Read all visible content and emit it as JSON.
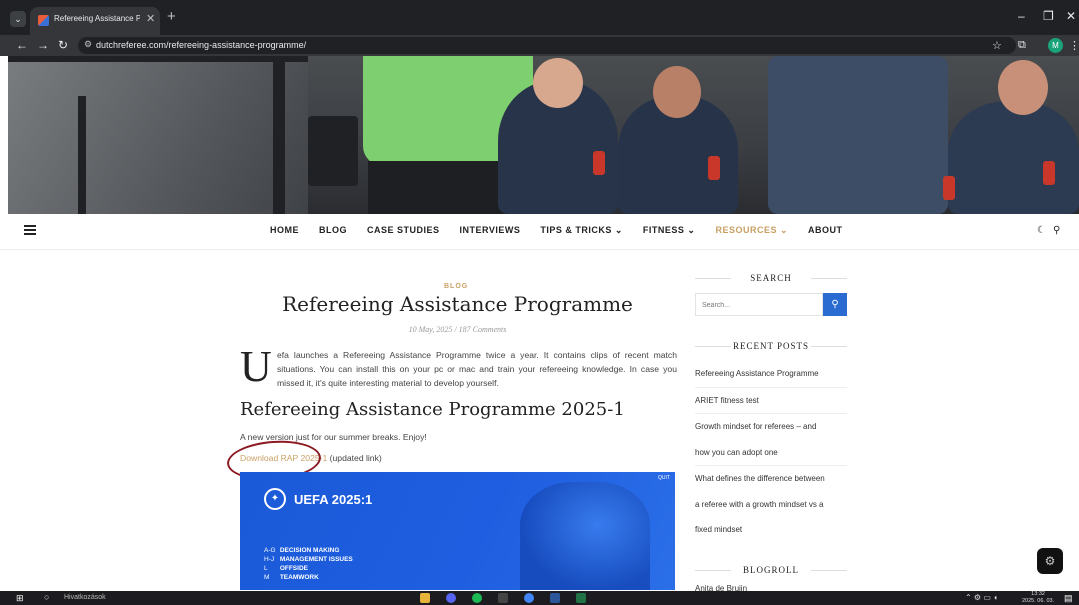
{
  "browser": {
    "tab_title": "Refereeing Assistance Program",
    "url": "dutchreferee.com/refereeing-assistance-programme/",
    "profile_initial": "M"
  },
  "nav": {
    "items": [
      {
        "label": "HOME"
      },
      {
        "label": "BLOG"
      },
      {
        "label": "CASE STUDIES"
      },
      {
        "label": "INTERVIEWS"
      },
      {
        "label": "TIPS & TRICKS ⌄"
      },
      {
        "label": "FITNESS ⌄"
      },
      {
        "label": "RESOURCES ⌄"
      },
      {
        "label": "ABOUT"
      }
    ],
    "active_color": "#c9a063"
  },
  "post": {
    "category": "BLOG",
    "title": "Refereeing Assistance Programme",
    "meta": "10 May, 2025 / 187 Comments",
    "dropcap": "U",
    "intro": "efa launches a Refereeing Assistance Programme twice a year. It contains clips of recent match situations. You can install this on your pc or mac and train your refereeing knowledge. In case you missed it, it's quite interesting material to develop yourself.",
    "subheading": "Refereeing Assistance Programme 2025-1",
    "paragraph": "A new version just for our summer breaks. Enjoy!",
    "download_link": "Download RAP 2025-1",
    "download_suffix": " (updated link)"
  },
  "banner": {
    "title": "UEFA 2025:1",
    "quit": "QUIT",
    "topics": [
      {
        "code": "A-G",
        "label": "DECISION MAKING"
      },
      {
        "code": "H-J",
        "label": "MANAGEMENT ISSUES"
      },
      {
        "code": "L",
        "label": "OFFSIDE"
      },
      {
        "code": "M",
        "label": "TEAMWORK"
      }
    ]
  },
  "sidebar": {
    "search_title": "SEARCH",
    "search_placeholder": "Search...",
    "recent_title": "RECENT POSTS",
    "recent_posts": [
      "Refereeing Assistance Programme",
      "ARIET fitness test",
      "Growth mindset for referees – and",
      "how you can adopt one",
      "What defines the difference between",
      "a referee with a growth mindset vs a",
      "fixed mindset"
    ],
    "blogroll_title": "BLOGROLL",
    "blogroll_first": "Anita de Bruijn"
  },
  "taskbar": {
    "search_label": "Hivatkozások",
    "time": "13:32",
    "date": "2025. 06. 03."
  }
}
